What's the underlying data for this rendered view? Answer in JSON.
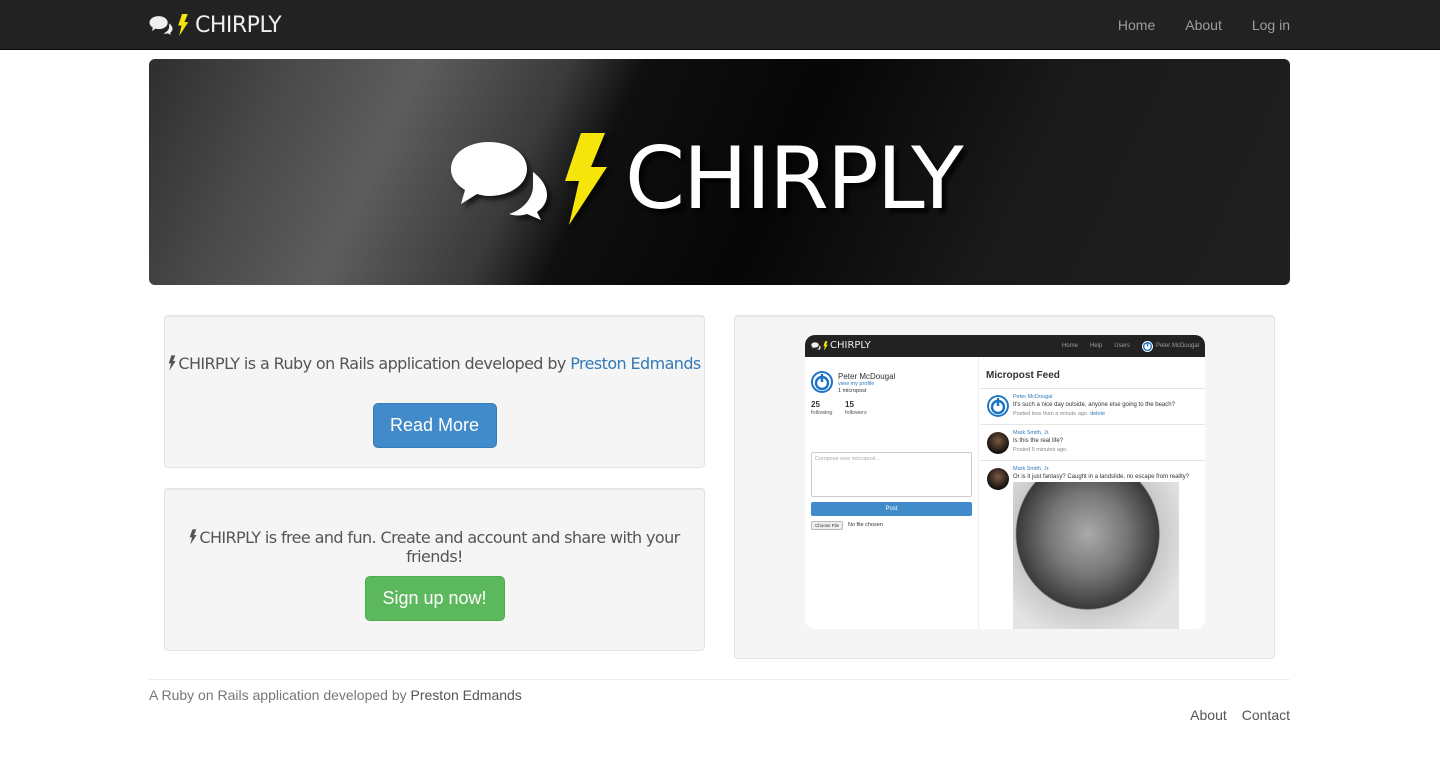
{
  "navbar": {
    "brand": "CHIRPLY",
    "links": [
      "Home",
      "About",
      "Log in"
    ]
  },
  "hero": {
    "title": "CHIRPLY"
  },
  "about_well": {
    "text_prefix": "CHIRPLY is a Ruby on Rails application developed by ",
    "author_link": "Preston Edmands",
    "button": "Read More"
  },
  "signup_well": {
    "text": "CHIRPLY is free and fun. Create and account and share with your friends!",
    "button": "Sign up now!"
  },
  "preview": {
    "brand": "CHIRPLY",
    "nav_links": [
      "Home",
      "Help",
      "Users"
    ],
    "current_user": "Peter McDougal",
    "profile": {
      "name": "Peter McDougal",
      "view_link": "view my profile",
      "count": "1 micropost",
      "following_count": "25",
      "following_label": "following",
      "followers_count": "15",
      "followers_label": "followers"
    },
    "compose_placeholder": "Compose new micropost...",
    "post_button": "Post",
    "file_button": "Choose File",
    "file_text": "No file chosen",
    "feed_title": "Micropost Feed",
    "feed": [
      {
        "user": "Peter McDougal",
        "message": "It's such a nice day outside, anyone else going to the beach?",
        "time": "Posted less than a minute ago.",
        "action": "delete"
      },
      {
        "user": "Mark Smith, Jr.",
        "message": "Is this the real life?",
        "time": "Posted 5 minutes ago."
      },
      {
        "user": "Mark Smith, Jr.",
        "message": "Or is it just fantasy? Caught in a landslide, no escape from reality?"
      }
    ]
  },
  "footer": {
    "text_prefix": "A Ruby on Rails application developed by ",
    "author": "Preston Edmands",
    "links": [
      "About",
      "Contact"
    ]
  },
  "colors": {
    "navbar_bg": "#222222",
    "bolt_yellow": "#f5e50a",
    "primary": "#428bca",
    "success": "#5cb85c",
    "link": "#337ab7"
  }
}
